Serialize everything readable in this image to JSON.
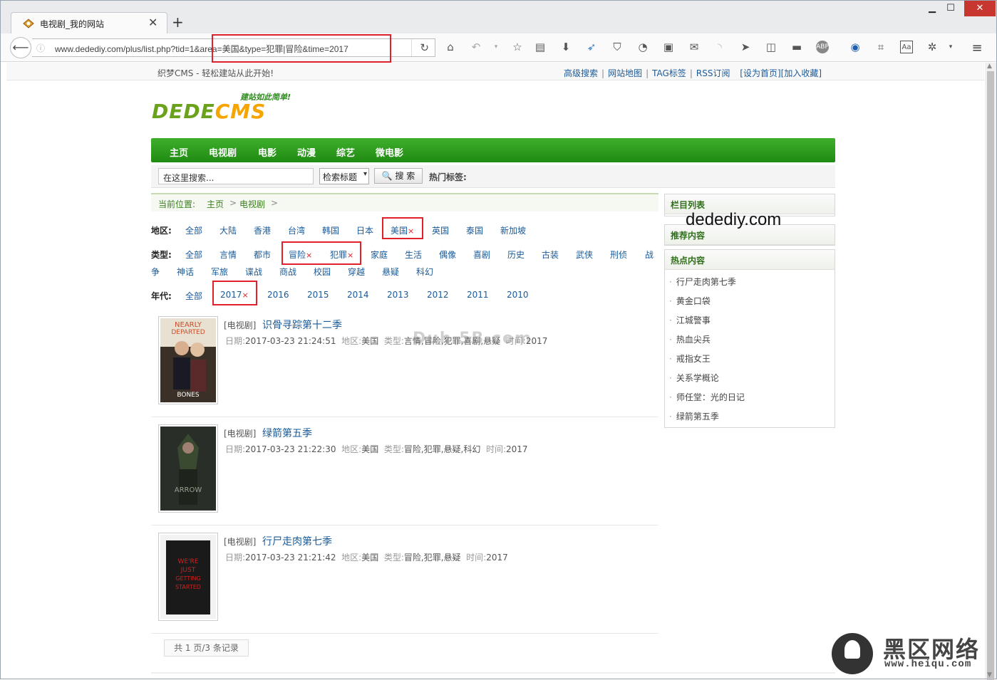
{
  "browser": {
    "tab_title": "电视剧_我的网站",
    "tab_close": "✕",
    "new_tab": "+",
    "url": "www.dedediy.com/plus/list.php?tid=1&area=美国&type=犯罪|冒险&time=2017",
    "win_min": "▁",
    "win_max": "☐",
    "win_close": "✕"
  },
  "topbar": {
    "slogan": "织梦CMS - 轻松建站从此开始!",
    "links": [
      "高级搜索",
      "网站地图",
      "TAG标签",
      "RSS订阅",
      "[设为首页]",
      "[加入收藏]"
    ]
  },
  "logo": {
    "tagline": "建站如此简单!",
    "text_a": "DEDE",
    "text_b": "CMS"
  },
  "nav": [
    "主页",
    "电视剧",
    "电影",
    "动漫",
    "综艺",
    "微电影"
  ],
  "search": {
    "placeholder": "在这里搜索...",
    "select": "检索标题",
    "button": "🔍 搜 索",
    "hot_label": "热门标签:"
  },
  "breadcrumb": [
    "当前位置:",
    "主页",
    ">",
    "电视剧",
    ">"
  ],
  "filters": {
    "area_label": "地区:",
    "area": [
      "全部",
      "大陆",
      "香港",
      "台湾",
      "韩国",
      "日本",
      "美国",
      "英国",
      "泰国",
      "新加坡"
    ],
    "type_label": "类型:",
    "type": [
      "全部",
      "言情",
      "都市",
      "冒险",
      "犯罪",
      "家庭",
      "生活",
      "偶像",
      "喜剧",
      "历史",
      "古装",
      "武侠",
      "刑侦",
      "战",
      "争",
      "神话",
      "军旅",
      "谍战",
      "商战",
      "校园",
      "穿越",
      "悬疑",
      "科幻"
    ],
    "year_label": "年代:",
    "year": [
      "全部",
      "2017",
      "2016",
      "2015",
      "2014",
      "2013",
      "2012",
      "2011",
      "2010"
    ],
    "remove_mark": "×"
  },
  "items": [
    {
      "category": "[电视剧]",
      "title": "识骨寻踪第十二季",
      "date_label": "日期:",
      "date": "2017-03-23 21:24:51",
      "area_label": "地区:",
      "area": "美国",
      "type_label": "类型:",
      "type": "言情,冒险,犯罪,喜剧,悬疑",
      "time_label": "时间:",
      "time": "2017",
      "poster_text": "NEARLY DEPARTED"
    },
    {
      "category": "[电视剧]",
      "title": "绿箭第五季",
      "date_label": "日期:",
      "date": "2017-03-23 21:22:30",
      "area_label": "地区:",
      "area": "美国",
      "type_label": "类型:",
      "type": "冒险,犯罪,悬疑,科幻",
      "time_label": "时间:",
      "time": "2017",
      "poster_text": "ARROW"
    },
    {
      "category": "[电视剧]",
      "title": "行尸走肉第七季",
      "date_label": "日期:",
      "date": "2017-03-23 21:21:42",
      "area_label": "地区:",
      "area": "美国",
      "type_label": "类型:",
      "type": "冒险,犯罪,悬疑",
      "time_label": "时间:",
      "time": "2017",
      "poster_text": "WE'RE JUST GETTING STARTED"
    }
  ],
  "pager": "共 1 页/3 条记录",
  "sidebar": {
    "column_list": "栏目列表",
    "recommend": "推荐内容",
    "hot": "热点内容",
    "hot_items": [
      "行尸走肉第七季",
      "黄金口袋",
      "江城警事",
      "热血尖兵",
      "戒指女王",
      "关系学概论",
      "师任堂：光的日记",
      "绿箭第五季"
    ]
  },
  "watermark": "dedediy.com",
  "ghost_watermark": "Duh 5B com",
  "heiqu": {
    "cn": "黑区网络",
    "en": "www.heiqu.com"
  },
  "colors": {
    "nav_green": "#2a9a1c",
    "link_blue": "#1a5a99",
    "highlight_red": "#e0202a"
  }
}
